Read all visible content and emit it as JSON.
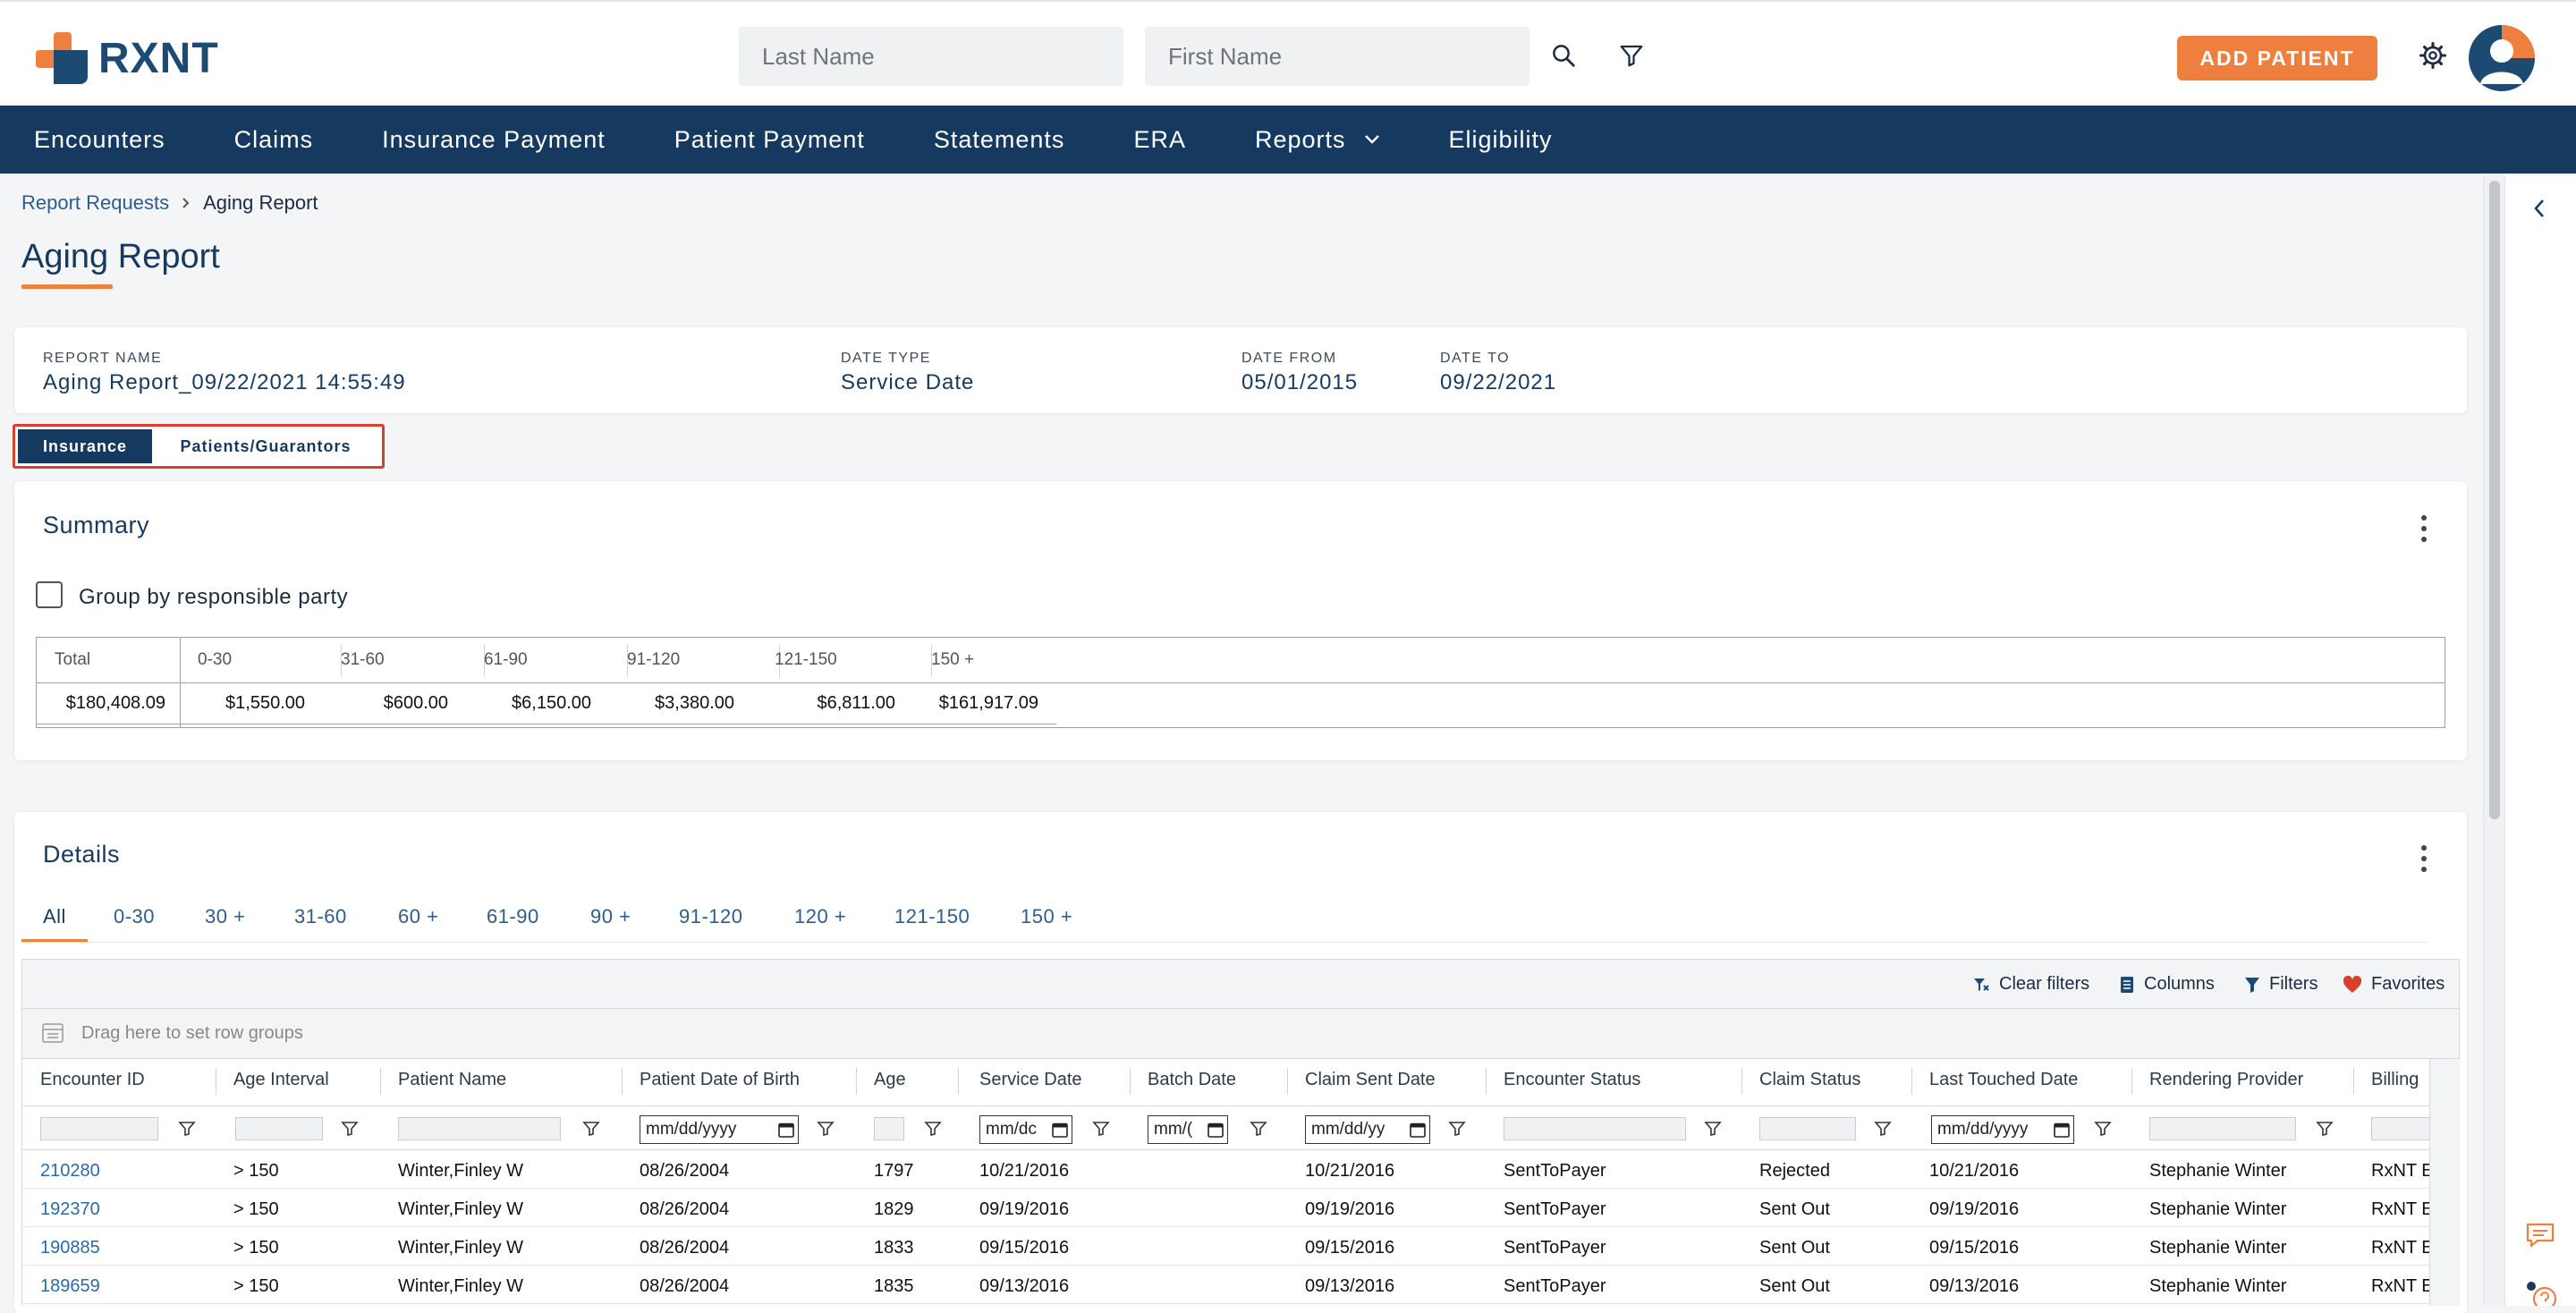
{
  "header": {
    "logo_text": "RXNT",
    "last_name_placeholder": "Last Name",
    "first_name_placeholder": "First Name",
    "add_patient_label": "ADD PATIENT"
  },
  "nav": {
    "items": [
      "Encounters",
      "Claims",
      "Insurance Payment",
      "Patient Payment",
      "Statements",
      "ERA",
      "Reports",
      "Eligibility"
    ]
  },
  "breadcrumb": {
    "parent": "Report Requests",
    "current": "Aging Report"
  },
  "page_title": "Aging Report",
  "report_meta": {
    "report_name_label": "REPORT NAME",
    "report_name": "Aging Report_09/22/2021 14:55:49",
    "date_type_label": "DATE TYPE",
    "date_type": "Service Date",
    "date_from_label": "DATE FROM",
    "date_from": "05/01/2015",
    "date_to_label": "DATE TO",
    "date_to": "09/22/2021"
  },
  "view_tabs": {
    "insurance": "Insurance",
    "patients": "Patients/Guarantors",
    "active": "Insurance"
  },
  "summary": {
    "title": "Summary",
    "group_by_label": "Group by responsible party",
    "group_by_checked": false,
    "headers": [
      "Total",
      "0-30",
      "31-60",
      "61-90",
      "91-120",
      "121-150",
      "150 +"
    ],
    "values": [
      "$180,408.09",
      "$1,550.00",
      "$600.00",
      "$6,150.00",
      "$3,380.00",
      "$6,811.00",
      "$161,917.09"
    ]
  },
  "details": {
    "title": "Details",
    "tabs": [
      "All",
      "0-30",
      "30 +",
      "31-60",
      "60 +",
      "61-90",
      "90 +",
      "91-120",
      "120 +",
      "121-150",
      "150 +"
    ],
    "active_tab": "All",
    "toolbar": {
      "clear_filters": "Clear filters",
      "columns": "Columns",
      "filters": "Filters",
      "favorites": "Favorites"
    },
    "group_bar_text": "Drag here to set row groups",
    "columns": [
      "Encounter ID",
      "Age Interval",
      "Patient Name",
      "Patient Date of Birth",
      "Age",
      "Service Date",
      "Batch Date",
      "Claim Sent Date",
      "Encounter Status",
      "Claim Status",
      "Last Touched Date",
      "Rendering Provider",
      "Billing"
    ],
    "date_filters": {
      "dob": "mm/dd/yyyy",
      "service": "mm/dc",
      "batch": "mm/(",
      "claim_sent": "mm/dd/yy",
      "last_touched": "mm/dd/yyyy"
    },
    "rows": [
      {
        "encounter_id": "210280",
        "age_interval": "> 150",
        "patient_name": "Winter,Finley W",
        "dob": "08/26/2004",
        "age": "1797",
        "service_date": "10/21/2016",
        "batch_date": "",
        "claim_sent_date": "10/21/2016",
        "encounter_status": "SentToPayer",
        "claim_status": "Rejected",
        "last_touched": "10/21/2016",
        "rendering_provider": "Stephanie Winter",
        "billing": "RxNT E"
      },
      {
        "encounter_id": "192370",
        "age_interval": "> 150",
        "patient_name": "Winter,Finley W",
        "dob": "08/26/2004",
        "age": "1829",
        "service_date": "09/19/2016",
        "batch_date": "",
        "claim_sent_date": "09/19/2016",
        "encounter_status": "SentToPayer",
        "claim_status": "Sent Out",
        "last_touched": "09/19/2016",
        "rendering_provider": "Stephanie Winter",
        "billing": "RxNT E"
      },
      {
        "encounter_id": "190885",
        "age_interval": "> 150",
        "patient_name": "Winter,Finley W",
        "dob": "08/26/2004",
        "age": "1833",
        "service_date": "09/15/2016",
        "batch_date": "",
        "claim_sent_date": "09/15/2016",
        "encounter_status": "SentToPayer",
        "claim_status": "Sent Out",
        "last_touched": "09/15/2016",
        "rendering_provider": "Stephanie Winter",
        "billing": "RxNT E"
      },
      {
        "encounter_id": "189659",
        "age_interval": "> 150",
        "patient_name": "Winter,Finley W",
        "dob": "08/26/2004",
        "age": "1835",
        "service_date": "09/13/2016",
        "batch_date": "",
        "claim_sent_date": "09/13/2016",
        "encounter_status": "SentToPayer",
        "claim_status": "Sent Out",
        "last_touched": "09/13/2016",
        "rendering_provider": "Stephanie Winter",
        "billing": "RxNT E"
      }
    ]
  },
  "colors": {
    "brand_navy": "#163a5f",
    "brand_orange": "#ef7f3e",
    "link_blue": "#2d6aa8",
    "highlight_red": "#d9402c"
  }
}
